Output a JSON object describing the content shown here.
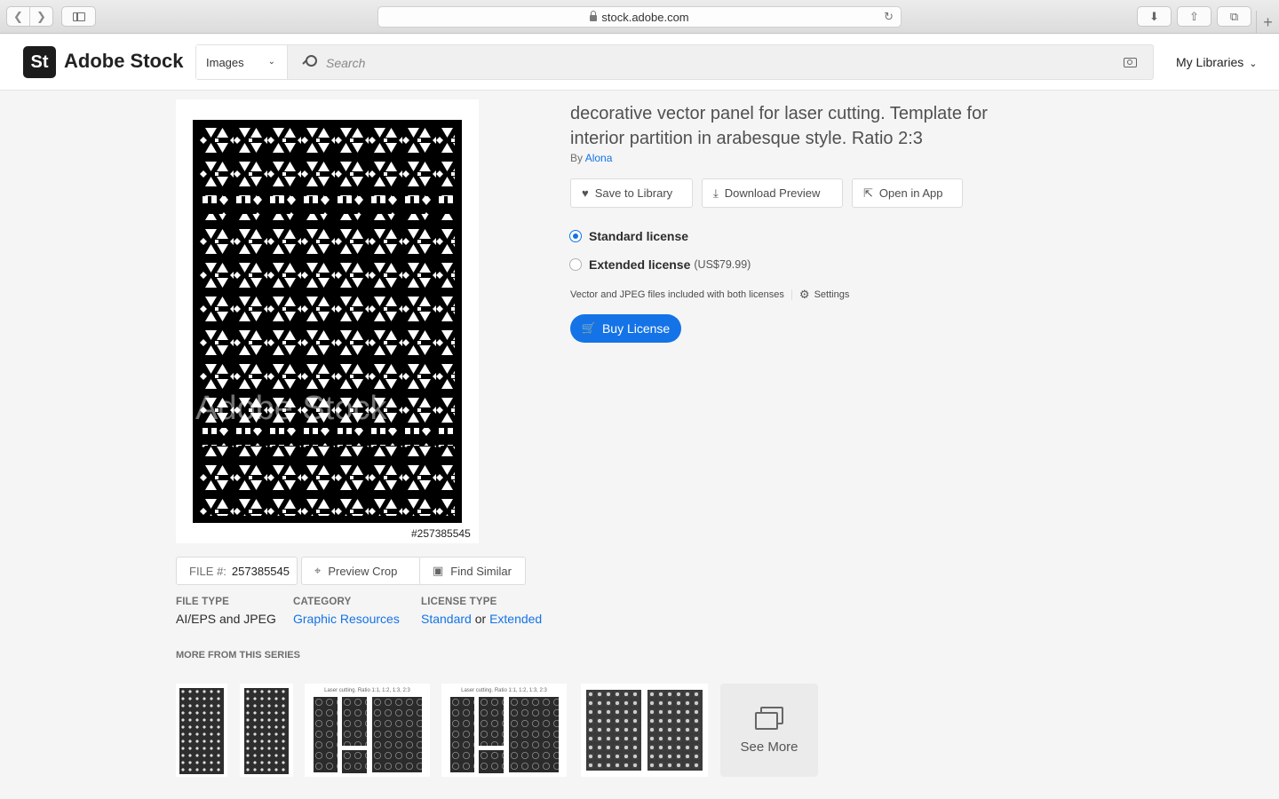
{
  "browser": {
    "url": "stock.adobe.com"
  },
  "header": {
    "logo_badge": "St",
    "logo_text": "Adobe Stock",
    "search_type": "Images",
    "search_placeholder": "Search",
    "my_libraries": "My Libraries"
  },
  "asset": {
    "title": "decorative vector panel for laser cutting. Template for interior partition in arabesque style. Ratio 2:3",
    "by_prefix": "By",
    "author": "Alona",
    "watermark": "Adobe Stock",
    "id_caption": "#257385545"
  },
  "actions": {
    "save": "Save to Library",
    "download": "Download Preview",
    "open": "Open in App"
  },
  "licenses": {
    "standard": "Standard license",
    "extended": "Extended license",
    "extended_price": "(US$79.99)",
    "selected": "standard",
    "note": "Vector and JPEG files included with both licenses",
    "settings": "Settings",
    "buy": "Buy License"
  },
  "file_meta": {
    "file_label": "FILE #:",
    "file_number": "257385545",
    "preview_crop": "Preview Crop",
    "find_similar": "Find Similar",
    "file_type_label": "FILE TYPE",
    "file_type": "AI/EPS and JPEG",
    "category_label": "CATEGORY",
    "category": "Graphic Resources",
    "license_type_label": "LICENSE TYPE",
    "license_standard": "Standard",
    "license_or": "or",
    "license_extended": "Extended"
  },
  "series": {
    "label": "MORE FROM THIS SERIES",
    "thumb3_caption": "Laser cutting. Ratio 1:1, 1:2, 1:3, 2:3",
    "thumb4_caption": "Laser cutting. Ratio 1:1, 1:2, 1:3, 2:3",
    "see_more": "See More"
  }
}
